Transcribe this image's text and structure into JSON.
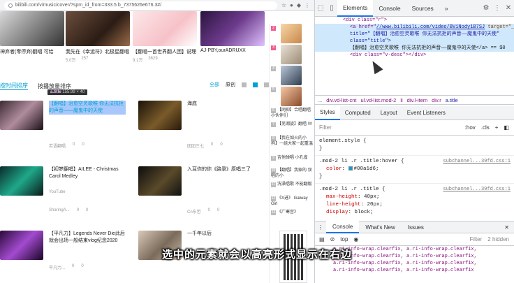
{
  "browser": {
    "url": "bilibili.com/v/music/cover/?spm_id_from=333.5.b_7375626e676.3#/",
    "icons": [
      "star",
      "account",
      "extensions",
      "menu"
    ]
  },
  "top_cards": [
    {
      "title": "神弃者(零停弃)翻唱 可给",
      "meta1": "",
      "meta2": ""
    },
    {
      "title": "我先在《幸运符》北极星翻唱",
      "meta1": "5.0万",
      "meta2": "257"
    },
    {
      "title": "【翻唱一首世界翻人团】说理",
      "meta1": "9.1万",
      "meta2": "3629"
    },
    {
      "title": "AJ-PBY,ourADRUXX",
      "meta1": "",
      "meta2": ""
    }
  ],
  "tabs": [
    {
      "label": "按时间排序",
      "active": true
    },
    {
      "label": "按播放量排序",
      "active": false
    }
  ],
  "view_controls": {
    "all": "全部",
    "original": "原创"
  },
  "tooltip": {
    "tag": "a.title",
    "size": "155.99 × 40"
  },
  "videos": [
    {
      "title": "【翻唱】治愈空灵歌喉 你无法抗拒的声音——魔鬼中的天使",
      "up": "",
      "author": "若语翻唱",
      "plays": "0",
      "danmaku": "0",
      "highlighted": true
    },
    {
      "title": "海底",
      "up": "",
      "author": "团团三七",
      "plays": "0",
      "danmaku": "0",
      "highlighted": false
    },
    {
      "title": "【初梦翻唱】AILEE - Christmas Carol Medley",
      "up": "YouTube",
      "author": "SharingA...",
      "plays": "0",
      "danmaku": "0",
      "highlighted": false
    },
    {
      "title": "入耳你的你《路录》原唱三了",
      "up": "",
      "author": "Cn东哲",
      "plays": "0",
      "danmaku": "0",
      "highlighted": false
    },
    {
      "title": "【平凡力】Legends Never Die此后就会出场一般结束vlog纪念2020",
      "up": "",
      "author": "平凡力...",
      "plays": "0",
      "danmaku": "0",
      "highlighted": false
    },
    {
      "title": "一千年以后",
      "up": "",
      "author": "",
      "plays": "",
      "danmaku": "",
      "highlighted": false
    }
  ],
  "rank_list": [
    {
      "rank": "2",
      "title": "",
      "gray": false
    },
    {
      "rank": "3",
      "title": "",
      "gray": false
    },
    {
      "rank": "4",
      "title": "",
      "gray": true
    },
    {
      "rank": "5",
      "title": "",
      "gray": true
    },
    {
      "rank": "6",
      "title": "【网抑】合唱翻唱 小伙伴们",
      "gray": true
    },
    {
      "rank": "7",
      "title": "【芜湖旋】翻唱 !!!!",
      "gray": true
    },
    {
      "rank": "8",
      "title": "【我在如火的小狗】一组大家一起重温",
      "gray": true
    },
    {
      "rank": "9",
      "title": "吉他弹唱 小孔雀",
      "gray": true
    },
    {
      "rank": "10",
      "title": "【翻唱】我家的 双唱的小",
      "gray": true
    },
    {
      "rank": "11",
      "title": "洗澡唱歌 不能翻版",
      "gray": true
    },
    {
      "rank": "12",
      "title": "《X进》 Galway Girl",
      "gray": true
    },
    {
      "rank": "13",
      "title": "《广寒宫》",
      "gray": true
    }
  ],
  "devtools": {
    "tabs": [
      "Elements",
      "Console",
      "Sources"
    ],
    "active_tab": "Elements",
    "more": "»",
    "elements": {
      "line1": "<div class=\"r\">",
      "line2_tag": "<a href=\"",
      "line2_link": "//www.bilibili.com/video/BV1Nody1B7SJ",
      "line2_attr": " target=\"_blank\"",
      "line3": "title=\"【翻唱】治愈空灵歌喉 你无法抗拒的声音——魔鬼中的天使\" class=\"title\">",
      "line4": "【翻唱】治愈空灵歌喉 你无法抗拒的声音——魔鬼中的天使</a> == $0",
      "line5": "<div class=\"v-desc\"></div>"
    },
    "breadcrumbs": [
      "...",
      "div.vd-list-cnt",
      "ul.vd-list.mod-2",
      "li",
      "div.l-item",
      "div.r",
      "a.title"
    ],
    "styles_tabs": [
      "Styles",
      "Computed",
      "Layout",
      "Event Listeners"
    ],
    "filter_placeholder": "Filter",
    "filter_hov": ":hov",
    "filter_cls": ".cls",
    "rules": [
      {
        "selector": "element.style {",
        "src": "",
        "props": []
      },
      {
        "selector": ".mod-2 li .r .title:hover {",
        "src": "subchannel...39fd.css:1",
        "props": [
          {
            "n": "color",
            "v": "#00a1d6;",
            "swatch": true
          }
        ]
      },
      {
        "selector": ".mod-2 li .r .title {",
        "src": "subchannel...39fd.css:1",
        "props": [
          {
            "n": "max-height",
            "v": "40px;"
          },
          {
            "n": "line-height",
            "v": "20px;"
          },
          {
            "n": "display",
            "v": "block;"
          }
        ]
      }
    ],
    "drawer_tabs": [
      "Console",
      "What's New",
      "Issues"
    ],
    "console_context": "top",
    "console_filter": "Filter",
    "console_hidden": "2 hidden",
    "console_lines": [
      "a.ri-info-wrap.clearfix, a.ri-info-wrap.clearfix,",
      "a.ri-info-wrap.clearfix, a.ri-info-wrap.clearfix,",
      "a.ri-info-wrap.clearfix, a.ri-info-wrap.clearfix,",
      "a.ri-info-wrap.clearfix, a.ri-info-wrap.clearfix"
    ]
  },
  "subtitle": "选中的元素就会以高亮形式显示在右边",
  "colors": {
    "accent": "#00a1d6",
    "devtools_blue": "#1a73e8",
    "tag_purple": "#881280"
  }
}
